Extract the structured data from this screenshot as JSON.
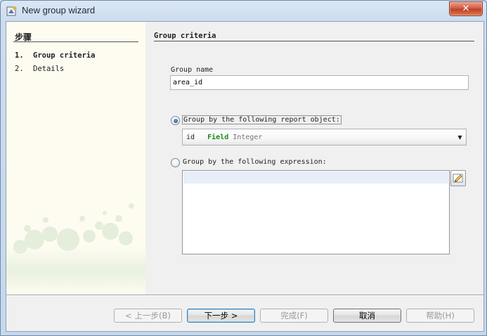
{
  "window": {
    "title": "New group wizard",
    "close_glyph": "✕"
  },
  "steps": {
    "heading": "步骤",
    "items": [
      {
        "num": "1.",
        "label": "Group criteria"
      },
      {
        "num": "2.",
        "label": "Details"
      }
    ]
  },
  "criteria": {
    "section_title": "Group criteria",
    "group_name_label": "Group name",
    "group_name_value": "area_id",
    "option_report_object": "Group by the following report object:",
    "option_expression": "Group by the following expression:",
    "selected_option": "report_object",
    "report_object": {
      "name": "id",
      "kind": "Field",
      "type": "Integer"
    },
    "combo_arrow": "▼",
    "expression_value": ""
  },
  "buttons": {
    "back": "< 上一步(B)",
    "next": "下一步 >",
    "finish": "完成(F)",
    "cancel": "取消",
    "help": "帮助(H)"
  },
  "icons": {
    "title": "wizard-icon",
    "close": "close-icon",
    "expression_builder": "expression-builder-icon",
    "dropdown": "chevron-down-icon"
  }
}
